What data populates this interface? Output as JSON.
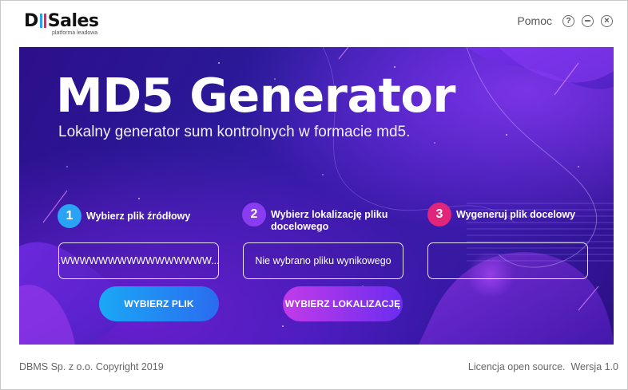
{
  "logo": {
    "text_a": "D",
    "text_b": "Sales",
    "subtitle": "platforma leadowa"
  },
  "topbar": {
    "help_label": "Pomoc",
    "help_icon_glyph": "?"
  },
  "banner": {
    "title": "MD5 Generator",
    "subtitle": "Lokalny generator sum kontrolnych w formacie md5."
  },
  "steps": [
    {
      "number": "1",
      "label": "Wybierz plik źródłowy",
      "color": "#2aa3f5"
    },
    {
      "number": "2",
      "label": "Wybierz lokalizację pliku docelowego",
      "color": "#8a3cf0"
    },
    {
      "number": "3",
      "label": "Wygeneruj plik docelowy",
      "color": "#e0257a"
    }
  ],
  "fields": {
    "source_value": ".WWWWWWWWWWWWWWWW...",
    "target_value": "Nie wybrano pliku wynikowego",
    "output_value": ""
  },
  "buttons": {
    "choose_file": "WYBIERZ PLIK",
    "choose_location": "WYBIERZ LOKALIZACJĘ"
  },
  "footer": {
    "copyright": "DBMS Sp. z o.o. Copyright 2019",
    "license": "Licencja open source.  Wersja 1.0"
  },
  "colors": {
    "logo_bar_1": "#2aa3f5",
    "logo_bar_2": "#e0257a",
    "btn1_from": "#1aa8f5",
    "btn1_to": "#2a6cf0",
    "btn2_from": "#c23be8",
    "btn2_to": "#6b2cf0"
  }
}
